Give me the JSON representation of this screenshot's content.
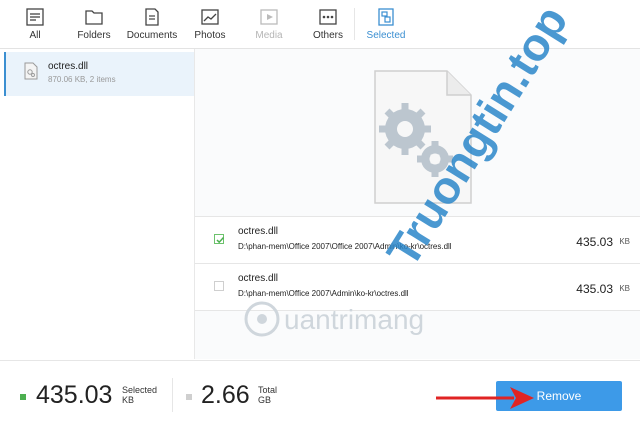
{
  "tabs": [
    {
      "label": "All",
      "icon": "list-icon",
      "state": "normal"
    },
    {
      "label": "Folders",
      "icon": "folder-icon",
      "state": "normal"
    },
    {
      "label": "Documents",
      "icon": "document-icon",
      "state": "normal"
    },
    {
      "label": "Photos",
      "icon": "photo-icon",
      "state": "normal"
    },
    {
      "label": "Media",
      "icon": "media-icon",
      "state": "disabled"
    },
    {
      "label": "Others",
      "icon": "others-icon",
      "state": "normal"
    },
    {
      "label": "Selected",
      "icon": "selected-icon",
      "state": "active"
    }
  ],
  "left_list": {
    "items": [
      {
        "name": "octres.dll",
        "meta": "870.06 KB, 2 items"
      }
    ]
  },
  "detail": {
    "files": [
      {
        "name": "octres.dll",
        "path": "D:\\phan-mem\\Office 2007\\Office 2007\\Admin\\ko-kr\\octres.dll",
        "size": "435.03",
        "unit": "KB",
        "checked": true
      },
      {
        "name": "octres.dll",
        "path": "D:\\phan-mem\\Office 2007\\Admin\\ko-kr\\octres.dll",
        "size": "435.03",
        "unit": "KB",
        "checked": false
      }
    ]
  },
  "footer": {
    "selected_value": "435.03",
    "selected_label": "Selected",
    "selected_unit": "KB",
    "total_value": "2.66",
    "total_label": "Total",
    "total_unit": "GB",
    "remove_label": "Remove"
  },
  "watermarks": {
    "brand": "Truongtin.top",
    "site": "uantrimang"
  },
  "colors": {
    "accent": "#3b8fd1",
    "button": "#3d9ae8",
    "selected_bullet": "#4caf50",
    "total_bullet": "#cfcfcf",
    "annotation_arrow": "#e02424",
    "watermark_blue": "#2a86c9",
    "watermark_red": "#e04444"
  }
}
